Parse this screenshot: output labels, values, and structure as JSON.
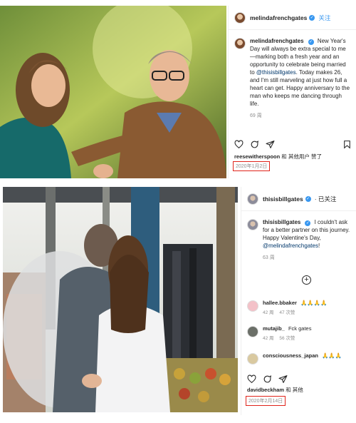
{
  "post1": {
    "username": "melindafrenchgates",
    "follow_label": "关注",
    "caption_user": "melindafrenchgates",
    "caption_text_1": "New Year's Day will always be extra special to me—marking both a fresh year and an opportunity to celebrate being married to",
    "caption_mention": "@thisisbillgates",
    "caption_text_2": ". Today makes 26, and I'm still marveling at just how full a heart can get. Happy anniversary to the man who keeps me dancing through life.",
    "caption_time": "69 周",
    "liked_by_user": "reesewitherspoon",
    "liked_by_rest": "和 其他用户 赞了",
    "date": "2020年1月2日"
  },
  "post2": {
    "username": "thisisbillgates",
    "follow_label": "· 已关注",
    "caption_user": "thisisbillgates",
    "caption_text_1": "I couldn't ask for a better partner on this journey. Happy Valentine's Day,",
    "caption_mention": "@melindafrenchgates",
    "caption_text_2": "!",
    "caption_time": "63 周",
    "add_label": "+",
    "comments": [
      {
        "user": "hallee.bbaker",
        "text": "🙏🙏🙏🙏",
        "time": "42 周",
        "likes": "47 次赞"
      },
      {
        "user": "mutajib_",
        "text": "Fck gates",
        "time": "42 周",
        "likes": "56 次赞"
      },
      {
        "user": "consciousness_japan",
        "text": "🙏🙏🙏",
        "time": "42 周",
        "likes": ""
      }
    ],
    "liked_by_user": "davidbeckham",
    "liked_by_rest": "和 其他",
    "date": "2020年2月14日"
  },
  "icons": [
    "verified-badge-icon",
    "heart-icon",
    "comment-icon",
    "share-icon",
    "bookmark-icon",
    "add-icon",
    "avatar"
  ],
  "colors": {
    "accent": "#3897f0",
    "highlight_box": "#e0241b",
    "muted": "#8e8e8e"
  }
}
